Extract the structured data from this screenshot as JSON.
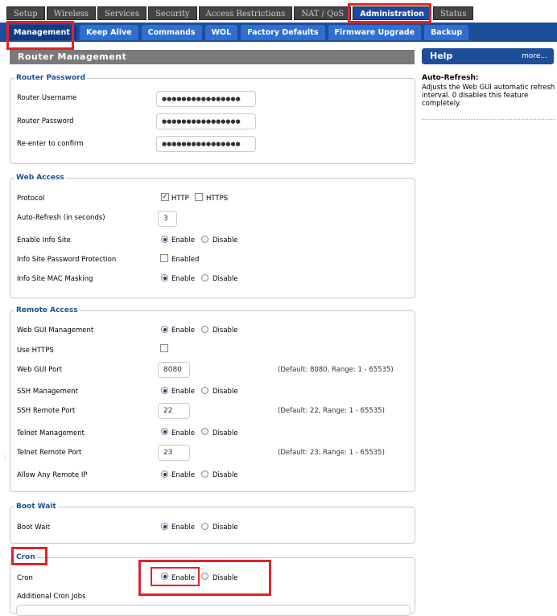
{
  "top_tabs": [
    "Setup",
    "Wireless",
    "Services",
    "Security",
    "Access Restrictions",
    "NAT / QoS",
    "Administration",
    "Status"
  ],
  "sub_tabs": [
    "Management",
    "Keep Alive",
    "Commands",
    "WOL",
    "Factory Defaults",
    "Firmware Upgrade",
    "Backup"
  ],
  "page_title": "Router Management",
  "help": {
    "title": "Help",
    "more": "more...",
    "topic": "Auto-Refresh:",
    "text": "Adjusts the Web GUI automatic refresh interval. 0 disables this feature completely."
  },
  "router_password": {
    "legend": "Router Password",
    "username_label": "Router Username",
    "username_value": "●●●●●●●●●●●●●●●●",
    "password_label": "Router Password",
    "password_value": "●●●●●●●●●●●●●●●●",
    "confirm_label": "Re-enter to confirm",
    "confirm_value": "●●●●●●●●●●●●●●●●"
  },
  "web_access": {
    "legend": "Web Access",
    "protocol_label": "Protocol",
    "http": "HTTP",
    "https": "HTTPS",
    "http_checked": true,
    "https_checked": false,
    "autorefresh_label": "Auto-Refresh (in seconds)",
    "autorefresh_value": "3",
    "info_site_label": "Enable Info Site",
    "info_pw_label": "Info Site Password Protection",
    "info_pw_opt": "Enabled",
    "info_mac_label": "Info Site MAC Masking"
  },
  "remote_access": {
    "legend": "Remote Access",
    "gui_mgmt_label": "Web GUI Management",
    "use_https_label": "Use HTTPS",
    "gui_port_label": "Web GUI Port",
    "gui_port_value": "8080",
    "gui_port_note": "(Default: 8080, Range: 1 - 65535)",
    "ssh_mgmt_label": "SSH Management",
    "ssh_port_label": "SSH Remote Port",
    "ssh_port_value": "22",
    "ssh_port_note": "(Default: 22, Range: 1 - 65535)",
    "telnet_mgmt_label": "Telnet Management",
    "telnet_port_label": "Telnet Remote Port",
    "telnet_port_value": "23",
    "telnet_port_note": "(Default: 23, Range: 1 - 65535)",
    "any_ip_label": "Allow Any Remote IP"
  },
  "boot_wait": {
    "legend": "Boot Wait",
    "label": "Boot Wait"
  },
  "cron": {
    "legend": "Cron",
    "label": "Cron",
    "jobs_label": "Additional Cron Jobs"
  },
  "enable": "Enable",
  "disable": "Disable",
  "colors": {
    "accent": "#1d4e9a",
    "highlight": "#e4202b",
    "header_gray": "#7a7a7a"
  }
}
